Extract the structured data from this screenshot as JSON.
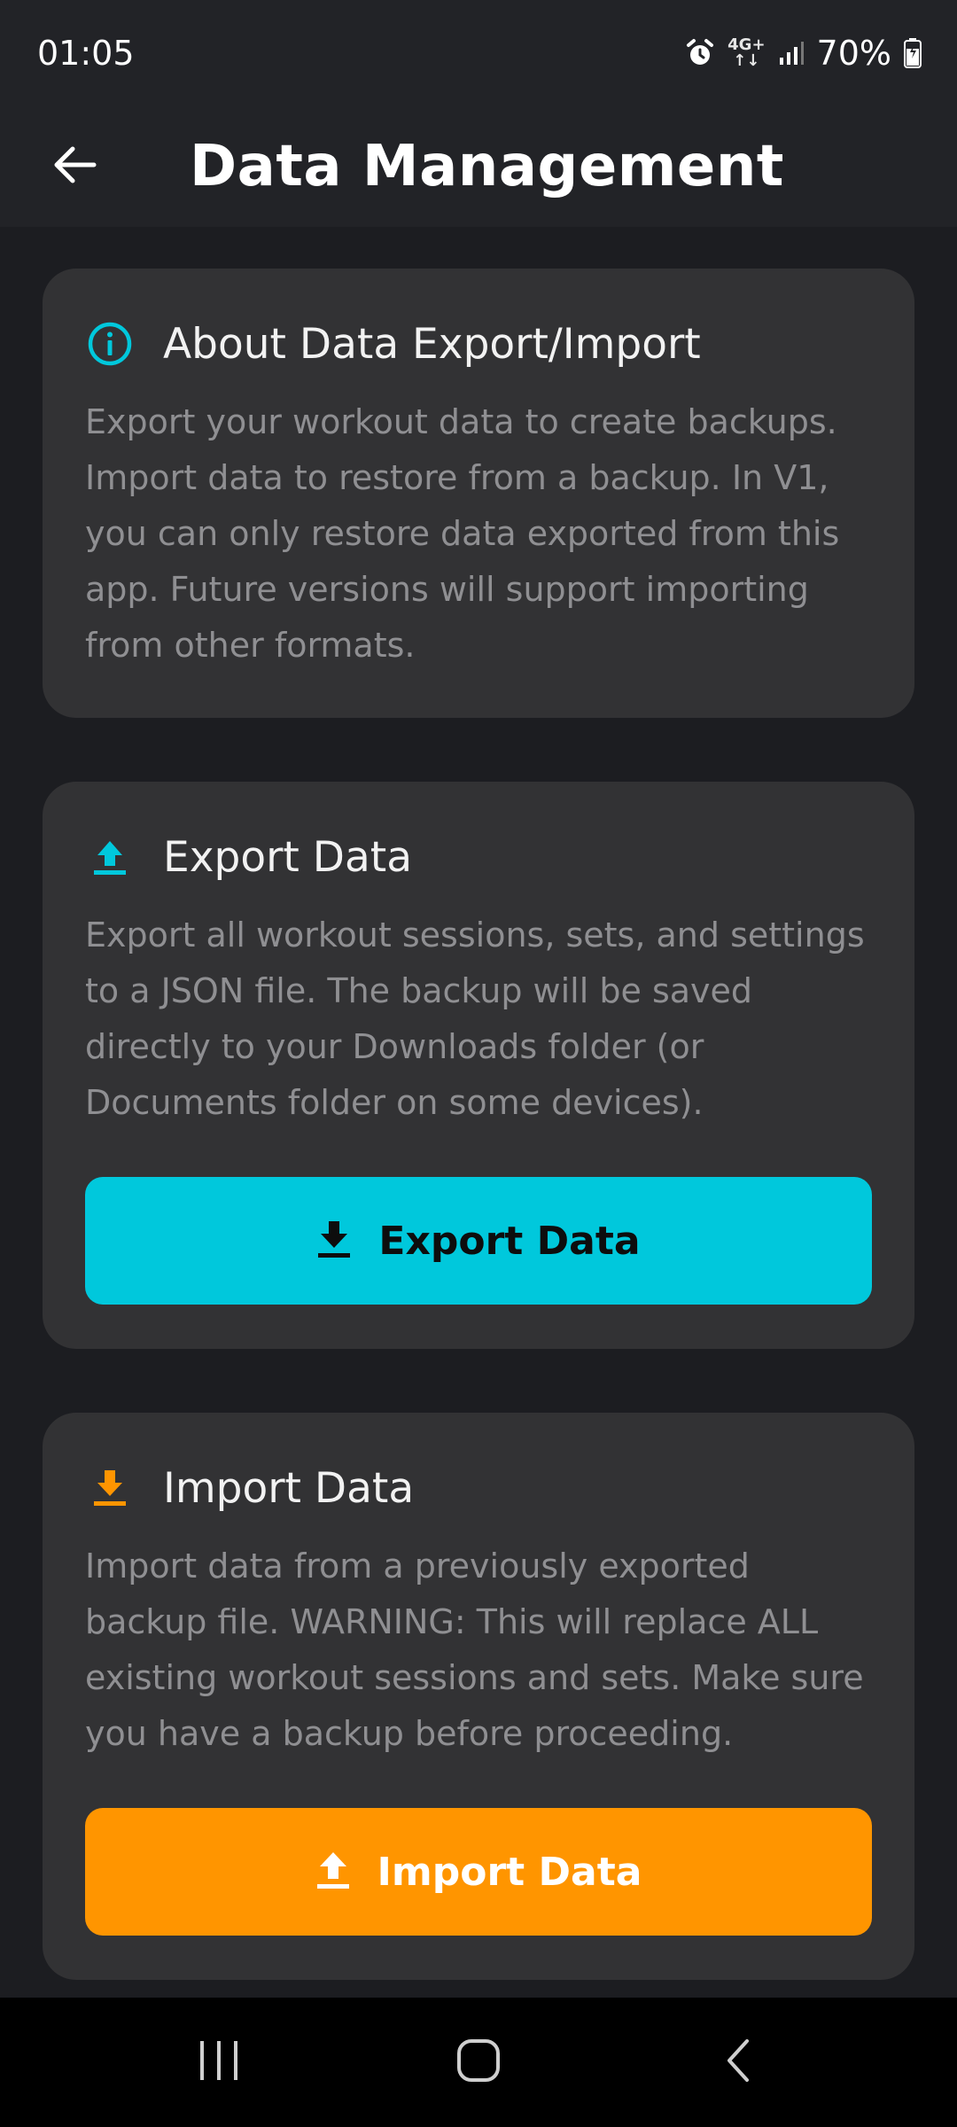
{
  "status_bar": {
    "time": "01:05",
    "network": "4G+",
    "battery": "70%"
  },
  "app_bar": {
    "title": "Data Management"
  },
  "about_card": {
    "title": "About Data Export/Import",
    "description": "Export your workout data to create backups. Import data to restore from a backup. In V1, you can only restore data exported from this app. Future versions will support importing from other formats.",
    "icon": "info-icon"
  },
  "export_card": {
    "title": "Export Data",
    "description": "Export all workout sessions, sets, and settings to a JSON file. The backup will be saved directly to your Downloads folder (or Documents folder on some devices).",
    "button_label": "Export Data",
    "icon": "upload-icon"
  },
  "import_card": {
    "title": "Import Data",
    "description": "Import data from a previously exported backup file. WARNING: This will replace ALL existing workout sessions and sets. Make sure you have a backup before proceeding.",
    "button_label": "Import Data",
    "icon": "download-icon"
  },
  "colors": {
    "accent_cyan": "#00c8dc",
    "accent_orange": "#ff9500",
    "background": "#1c1d21",
    "card": "#323234"
  }
}
